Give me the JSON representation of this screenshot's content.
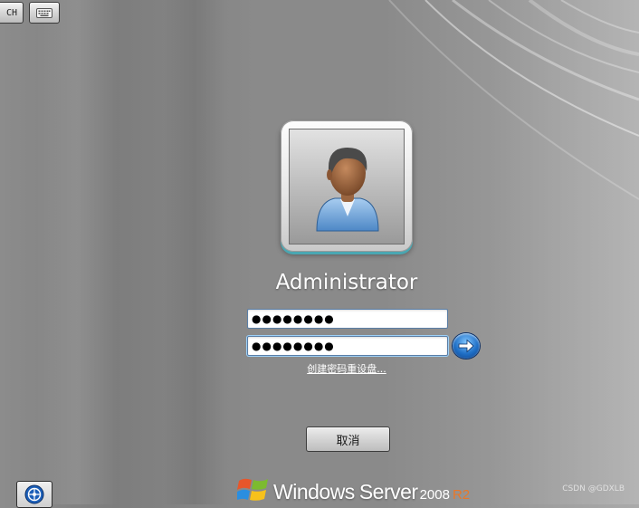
{
  "toolbar": {
    "language_label": "CH",
    "keyboard_icon": "keyboard-icon"
  },
  "login": {
    "user_name": "Administrator",
    "password_1_masked": "●●●●●●●●",
    "password_2_masked": "●●●●●●●●",
    "reset_disk_link": "创建密码重设盘...",
    "cancel_label": "取消",
    "submit_icon": "arrow-right-icon",
    "avatar_icon": "user-avatar-icon"
  },
  "footer": {
    "ease_of_access_icon": "ease-of-access-icon",
    "brand_windows": "Windows",
    "brand_server": "Server",
    "brand_version": "2008",
    "brand_r2": "R2",
    "watermark": "CSDN @GDXLB"
  },
  "colors": {
    "accent_blue": "#1f6fc6",
    "brand_orange": "#e8782a",
    "frame_teal": "#4aa7b2"
  }
}
